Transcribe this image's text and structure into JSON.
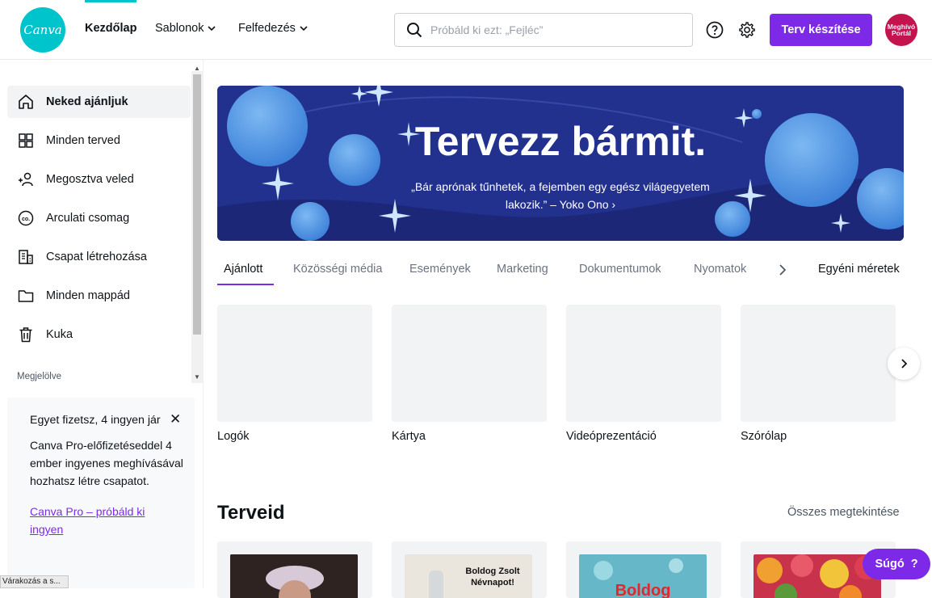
{
  "header": {
    "logo_text": "Canva",
    "nav": [
      {
        "label": "Kezdőlap"
      },
      {
        "label": "Sablonok"
      },
      {
        "label": "Felfedezés"
      }
    ],
    "search_placeholder": "Próbáld ki ezt: „Fejléc”",
    "create_button": "Terv készítése",
    "avatar_text": "Meghívó Portál"
  },
  "sidebar": {
    "items": [
      {
        "label": "Neked ajánljuk",
        "icon": "home-icon"
      },
      {
        "label": "Minden terved",
        "icon": "grid-icon"
      },
      {
        "label": "Megosztva veled",
        "icon": "shared-users-icon"
      },
      {
        "label": "Arculati csomag",
        "icon": "brand-kit-icon"
      },
      {
        "label": "Csapat létrehozása",
        "icon": "building-icon"
      },
      {
        "label": "Minden mappád",
        "icon": "folder-icon"
      },
      {
        "label": "Kuka",
        "icon": "trash-icon"
      }
    ],
    "section_label": "Megjelölve",
    "promo": {
      "title": "Egyet fizetsz, 4 ingyen jár",
      "text": "Canva Pro-előfizetéseddel 4 ember ingyenes meghívásával hozhatsz létre csapatot.",
      "link": "Canva Pro – próbáld ki ingyen"
    }
  },
  "status_bar": "Várakozás a s...",
  "hero": {
    "title": "Tervezz bármit.",
    "quote": "„Bár aprónak tűnhetek, a fejemben egy egész világegyetem lakozik.” – Yoko Ono ›"
  },
  "tabs": [
    {
      "label": "Ajánlott"
    },
    {
      "label": "Közösségi média"
    },
    {
      "label": "Események"
    },
    {
      "label": "Marketing"
    },
    {
      "label": "Dokumentumok"
    },
    {
      "label": "Nyomatok"
    },
    {
      "label": "Egyéni méretek"
    }
  ],
  "template_cards": [
    {
      "label": "Logók"
    },
    {
      "label": "Kártya"
    },
    {
      "label": "Videóprezentáció"
    },
    {
      "label": "Szórólap"
    }
  ],
  "designs": {
    "title": "Terveid",
    "see_all": "Összes megtekintése",
    "thumb_texts": [
      "Boldog Zsolt Névnapot!",
      "Boldog"
    ]
  },
  "help_button": "Súgó",
  "colors": {
    "brand_teal": "#00c4cc",
    "accent_purple": "#7d2ae8",
    "hero_blue": "#22308e"
  }
}
